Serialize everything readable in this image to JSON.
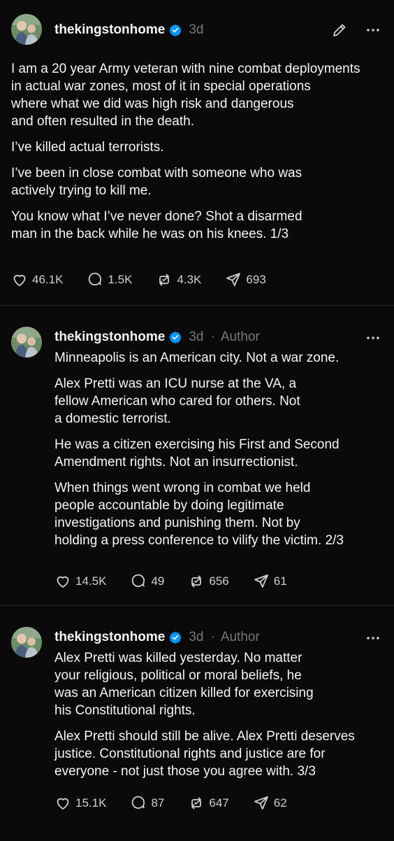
{
  "posts": [
    {
      "username": "thekingstonhome",
      "time": "3d",
      "author_label": "",
      "paragraphs": [
        "I am a 20 year Army veteran with nine combat deployments\nin actual war zones, most of it in special operations\nwhere what we did was high risk and dangerous\nand often resulted in the death.",
        "I’ve killed actual terrorists.",
        "I’ve been in close combat with someone who was\nactively trying to kill me.",
        "You know what I’ve never done? Shot a disarmed\nman in the back while he was on his knees. 1/3"
      ],
      "likes": "46.1K",
      "replies": "1.5K",
      "reposts": "4.3K",
      "shares": "693"
    },
    {
      "username": "thekingstonhome",
      "time": "3d",
      "author_label": "Author",
      "paragraphs": [
        "Minneapolis is an American city. Not a war zone.",
        "Alex Pretti was an ICU nurse at the VA, a\nfellow American who cared for others. Not\na domestic terrorist.",
        "He was a citizen exercising his First and Second\nAmendment rights. Not an insurrectionist.",
        "When things went wrong in combat we held\npeople accountable by doing legitimate\ninvestigations and punishing them. Not by\nholding a press conference to vilify the victim. 2/3"
      ],
      "likes": "14.5K",
      "replies": "49",
      "reposts": "656",
      "shares": "61"
    },
    {
      "username": "thekingstonhome",
      "time": "3d",
      "author_label": "Author",
      "paragraphs": [
        "Alex Pretti was killed yesterday. No matter\nyour religious, political or moral beliefs, he\nwas an American citizen killed for exercising\nhis Constitutional rights.",
        "Alex Pretti should still be alive. Alex Pretti deserves\njustice. Constitutional rights and justice are for\neveryone - not just those you agree with. 3/3"
      ],
      "likes": "15.1K",
      "replies": "87",
      "reposts": "647",
      "shares": "62"
    }
  ],
  "separator": "·",
  "colors": {
    "background": "#0a0a0a",
    "text": "#f3f5f7",
    "muted": "#777777",
    "verified": "#0095f6",
    "divider": "#2a2a2a"
  },
  "icons": [
    "edit-icon",
    "more-icon",
    "verified-icon",
    "heart-icon",
    "reply-icon",
    "repost-icon",
    "share-icon"
  ]
}
